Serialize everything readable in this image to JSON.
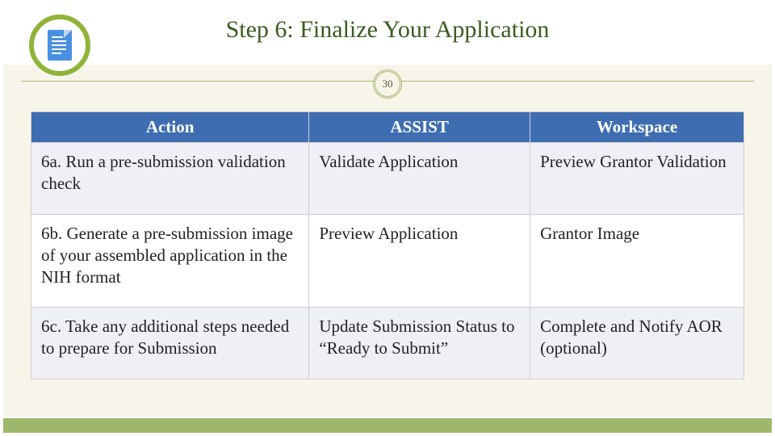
{
  "slide_number": "30",
  "title": "Step 6: Finalize Your Application",
  "table": {
    "headers": {
      "action": "Action",
      "assist": "ASSIST",
      "workspace": "Workspace"
    },
    "rows": [
      {
        "action": "6a. Run a pre-submission validation check",
        "assist": "Validate Application",
        "workspace": "Preview Grantor Validation"
      },
      {
        "action": "6b. Generate a pre-submission image of your assembled application in the NIH format",
        "assist": "Preview Application",
        "workspace": "Grantor Image"
      },
      {
        "action": "6c. Take any additional steps needed to prepare for Submission",
        "assist": "Update Submission Status to “Ready to Submit”",
        "workspace": "Complete and Notify AOR (optional)"
      }
    ]
  }
}
